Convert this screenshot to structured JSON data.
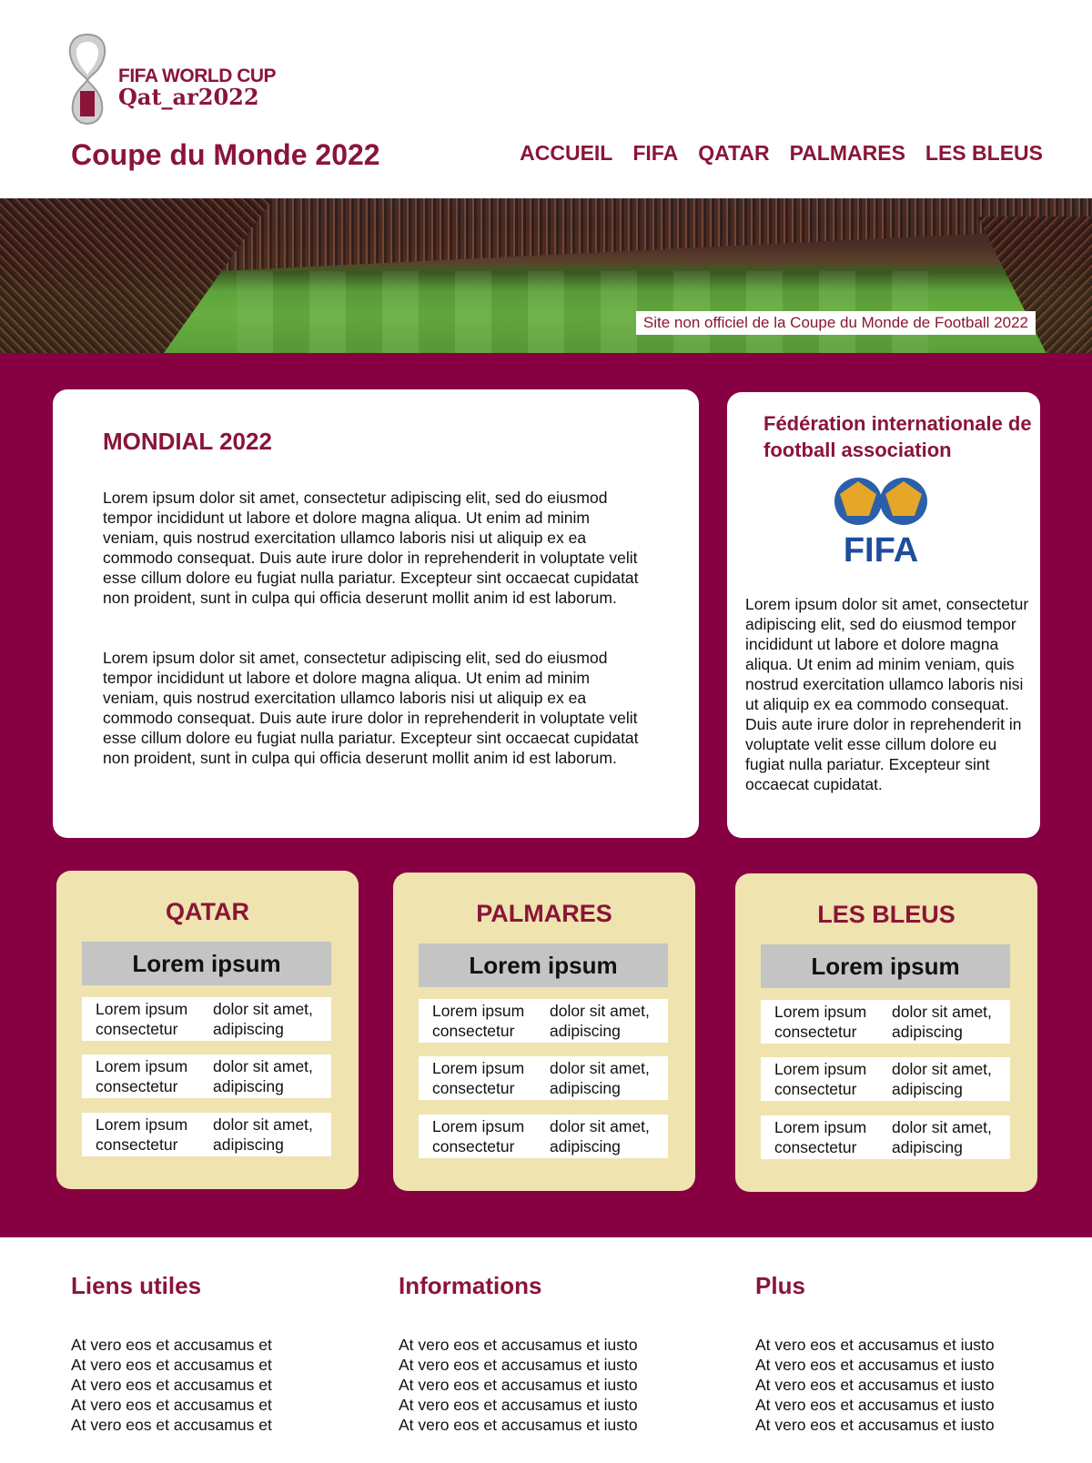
{
  "header": {
    "logo_line1": "FIFA WORLD CUP",
    "logo_line2": "Qat_ar2022",
    "title": "Coupe du Monde 2022",
    "nav": [
      "ACCUEIL",
      "FIFA",
      "QATAR",
      "PALMARES",
      "LES BLEUS"
    ]
  },
  "banner": {
    "caption": "Site non officiel de la Coupe du Monde de Football 2022"
  },
  "main_card": {
    "title": "MONDIAL 2022",
    "p1": "Lorem ipsum dolor sit amet, consectetur adipiscing elit, sed do eiusmod tempor incididunt ut labore et dolore magna aliqua. Ut enim ad minim veniam, quis nostrud exercitation ullamco laboris nisi ut aliquip ex ea commodo consequat. Duis aute irure dolor in reprehenderit in voluptate velit esse cillum dolore eu fugiat nulla pariatur. Excepteur sint occaecat cupidatat non proident, sunt in culpa qui officia deserunt mollit anim id est laborum.",
    "p2": "Lorem ipsum dolor sit amet, consectetur adipiscing elit, sed do eiusmod tempor incididunt ut labore et dolore magna aliqua. Ut enim ad minim veniam, quis nostrud exercitation ullamco laboris nisi ut aliquip ex ea commodo consequat. Duis aute irure dolor in reprehenderit in voluptate velit esse cillum dolore eu fugiat nulla pariatur. Excepteur sint occaecat cupidatat non proident, sunt in culpa qui officia deserunt mollit anim id est laborum."
  },
  "fifa_card": {
    "title": "Fédération internationale de football association",
    "logo_text": "FIFA",
    "body": "Lorem ipsum dolor sit amet, consectetur adipiscing elit, sed do eiusmod tempor incididunt ut labore et dolore magna aliqua. Ut enim ad minim veniam, quis nostrud exercitation ullamco laboris nisi ut aliquip ex ea commodo consequat. Duis aute irure dolor in reprehenderit in voluptate velit esse cillum dolore eu fugiat nulla pariatur. Excepteur sint occaecat cupidatat."
  },
  "boxes": [
    {
      "title": "QATAR",
      "subtitle": "Lorem ipsum",
      "rows": [
        {
          "c1": "Lorem ipsum consectetur",
          "c2": "dolor sit amet, adipiscing"
        },
        {
          "c1": "Lorem ipsum consectetur",
          "c2": "dolor sit amet, adipiscing"
        },
        {
          "c1": "Lorem ipsum consectetur",
          "c2": "dolor sit amet, adipiscing"
        }
      ]
    },
    {
      "title": "PALMARES",
      "subtitle": "Lorem ipsum",
      "rows": [
        {
          "c1": "Lorem ipsum consectetur",
          "c2": "dolor sit amet, adipiscing"
        },
        {
          "c1": "Lorem ipsum consectetur",
          "c2": "dolor sit amet, adipiscing"
        },
        {
          "c1": "Lorem ipsum consectetur",
          "c2": "dolor sit amet, adipiscing"
        }
      ]
    },
    {
      "title": "LES BLEUS",
      "subtitle": "Lorem ipsum",
      "rows": [
        {
          "c1": "Lorem ipsum consectetur",
          "c2": "dolor sit amet, adipiscing"
        },
        {
          "c1": "Lorem ipsum consectetur",
          "c2": "dolor sit amet, adipiscing"
        },
        {
          "c1": "Lorem ipsum consectetur",
          "c2": "dolor sit amet, adipiscing"
        }
      ]
    }
  ],
  "footer": {
    "columns": [
      {
        "title": "Liens utiles",
        "links": [
          "At vero eos et accusamus et",
          "At vero eos et accusamus et",
          "At vero eos et accusamus et",
          "At vero eos et accusamus et",
          "At vero eos et accusamus et"
        ]
      },
      {
        "title": "Informations",
        "links": [
          "At vero eos et accusamus et iusto",
          "At vero eos et accusamus et iusto",
          "At vero eos et accusamus et iusto",
          "At vero eos et accusamus et iusto",
          "At vero eos et accusamus et iusto"
        ]
      },
      {
        "title": "Plus",
        "links": [
          "At vero eos et accusamus et iusto",
          "At vero eos et accusamus et iusto",
          "At vero eos et accusamus et iusto",
          "At vero eos et accusamus et iusto",
          "At vero eos et accusamus et iusto"
        ]
      }
    ]
  },
  "colors": {
    "brand": "#8a1538",
    "main_bg": "#870042",
    "box_bg": "#efe3b0",
    "subtitle_bg": "#c4c4c4"
  }
}
